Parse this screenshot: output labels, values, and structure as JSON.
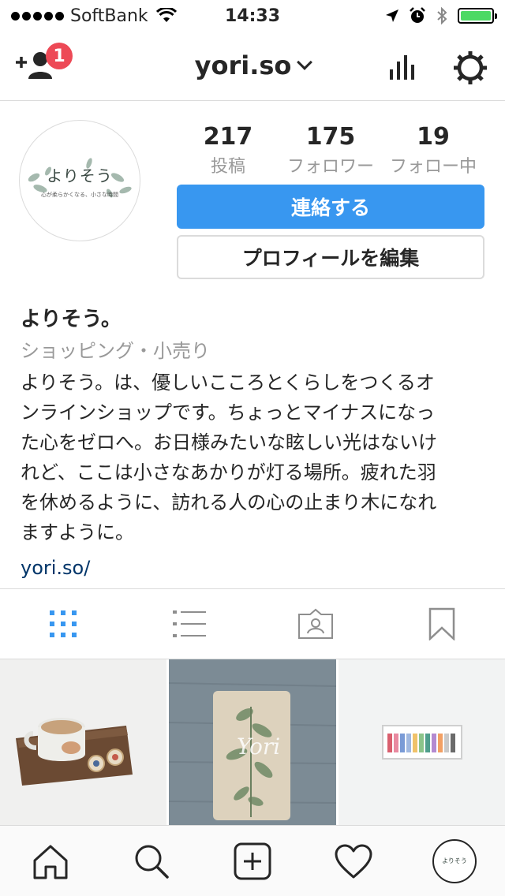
{
  "status_bar": {
    "carrier": "SoftBank",
    "time": "14:33",
    "battery_level": 1.0,
    "colors": {
      "battery": "#4cd964"
    }
  },
  "nav": {
    "title": "yori.so",
    "notification_count": "1",
    "icons": [
      "add-user-icon",
      "chevron-down-icon",
      "insights-icon",
      "gear-icon"
    ]
  },
  "profile": {
    "avatar_logo": "よりそう",
    "avatar_tagline": "心が柔らかくなる、小さな時間",
    "stats": [
      {
        "value": "217",
        "label": "投稿"
      },
      {
        "value": "175",
        "label": "フォロワー"
      },
      {
        "value": "19",
        "label": "フォロー中"
      }
    ],
    "contact_button": "連絡する",
    "edit_button": "プロフィールを編集"
  },
  "bio": {
    "name": "よりそう。",
    "category": "ショッピング・小売り",
    "lines": [
      "よりそう。は、優しいこころとくらしをつくるオ",
      "ンラインショップです。ちょっとマイナスになっ",
      "た心をゼロへ。お日様みたいな眩しい光はないけ",
      "れど、ここは小さなあかりが灯る場所。疲れた羽",
      "を休めるように、訪れる人の心の止まり木になれ",
      "ますように。"
    ],
    "link": "yori.so/"
  },
  "tabs": [
    "grid-icon",
    "list-icon",
    "tagged-icon",
    "bookmark-icon"
  ],
  "colors": {
    "accent": "#3897f0",
    "badge": "#ed4956",
    "link": "#003569",
    "muted": "#999999",
    "border": "#dbdbdb"
  },
  "bottom_bar": [
    "home-icon",
    "search-icon",
    "new-post-icon",
    "activity-icon",
    "profile-avatar"
  ]
}
